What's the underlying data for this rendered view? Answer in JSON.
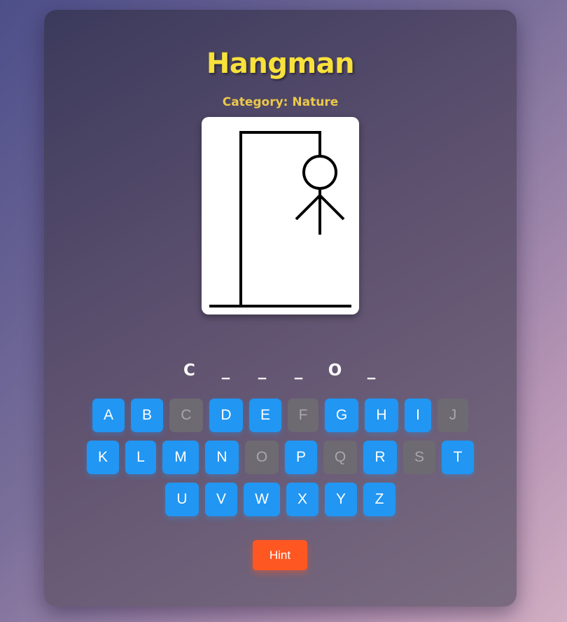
{
  "title": "Hangman",
  "category": "Category: Nature",
  "word_slots": [
    "C",
    "_",
    "_",
    "_",
    "O",
    "_"
  ],
  "keyboard": {
    "row1": [
      {
        "letter": "A",
        "used": false
      },
      {
        "letter": "B",
        "used": false
      },
      {
        "letter": "C",
        "used": true
      },
      {
        "letter": "D",
        "used": false
      },
      {
        "letter": "E",
        "used": false
      },
      {
        "letter": "F",
        "used": true
      },
      {
        "letter": "G",
        "used": false
      },
      {
        "letter": "H",
        "used": false
      },
      {
        "letter": "I",
        "used": false
      },
      {
        "letter": "J",
        "used": true
      }
    ],
    "row2": [
      {
        "letter": "K",
        "used": false
      },
      {
        "letter": "L",
        "used": false
      },
      {
        "letter": "M",
        "used": false
      },
      {
        "letter": "N",
        "used": false
      },
      {
        "letter": "O",
        "used": true
      },
      {
        "letter": "P",
        "used": false
      },
      {
        "letter": "Q",
        "used": true
      },
      {
        "letter": "R",
        "used": false
      },
      {
        "letter": "S",
        "used": true
      },
      {
        "letter": "T",
        "used": false
      }
    ],
    "row3": [
      {
        "letter": "U",
        "used": false
      },
      {
        "letter": "V",
        "used": false
      },
      {
        "letter": "W",
        "used": false
      },
      {
        "letter": "X",
        "used": false
      },
      {
        "letter": "Y",
        "used": false
      },
      {
        "letter": "Z",
        "used": false
      }
    ]
  },
  "hint_label": "Hint",
  "hangman_parts_shown": [
    "head",
    "body",
    "left-arm",
    "right-arm"
  ],
  "colors": {
    "title": "#f7e13b",
    "category": "#ecc84a",
    "key_active": "#2196f3",
    "key_used": "#6d6a72",
    "hint_button": "#ff5722"
  }
}
